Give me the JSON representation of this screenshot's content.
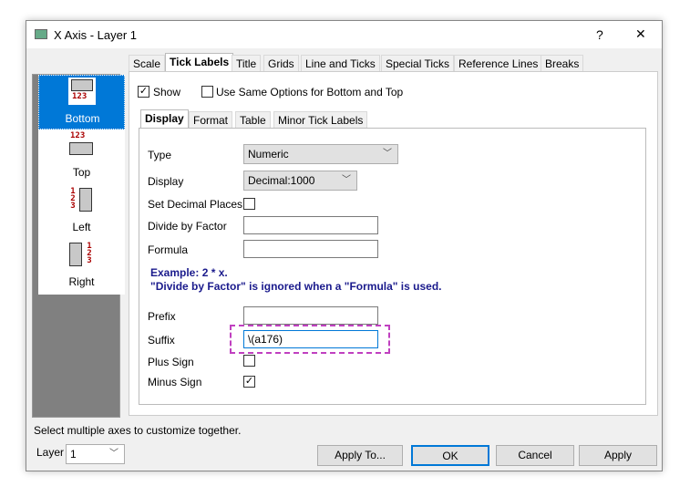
{
  "window": {
    "title": "X Axis - Layer 1",
    "help": "?",
    "close": "✕"
  },
  "tabs": [
    {
      "label": "Scale"
    },
    {
      "label": "Tick Labels",
      "active": true
    },
    {
      "label": "Title"
    },
    {
      "label": "Grids"
    },
    {
      "label": "Line and Ticks"
    },
    {
      "label": "Special Ticks"
    },
    {
      "label": "Reference Lines"
    },
    {
      "label": "Breaks"
    }
  ],
  "sidebar": {
    "items": [
      {
        "label": "Bottom",
        "selected": true,
        "digits": "123"
      },
      {
        "label": "Top",
        "digits": "123"
      },
      {
        "label": "Left",
        "digits": "123"
      },
      {
        "label": "Right",
        "digits": "123"
      }
    ]
  },
  "show": {
    "label": "Show",
    "checked": true
  },
  "same_options": {
    "label": "Use Same Options for Bottom and Top",
    "checked": false
  },
  "subtabs": [
    {
      "label": "Display",
      "active": true
    },
    {
      "label": "Format"
    },
    {
      "label": "Table"
    },
    {
      "label": "Minor Tick Labels"
    }
  ],
  "form": {
    "type": {
      "label": "Type",
      "value": "Numeric"
    },
    "display": {
      "label": "Display",
      "value": "Decimal:1000"
    },
    "set_decimal": {
      "label": "Set Decimal Places",
      "checked": false
    },
    "divide": {
      "label": "Divide by Factor",
      "value": ""
    },
    "formula": {
      "label": "Formula",
      "value": ""
    },
    "note1": "Example: 2 * x.",
    "note2": "\"Divide by Factor\" is ignored when a \"Formula\" is used.",
    "prefix": {
      "label": "Prefix",
      "value": ""
    },
    "suffix": {
      "label": "Suffix",
      "value": "\\(a176)"
    },
    "plus": {
      "label": "Plus Sign",
      "checked": false
    },
    "minus": {
      "label": "Minus Sign",
      "checked": true
    }
  },
  "status": "Select multiple axes to customize together.",
  "layer": {
    "label": "Layer",
    "value": "1"
  },
  "buttons": {
    "apply_to": "Apply To...",
    "ok": "OK",
    "cancel": "Cancel",
    "apply": "Apply"
  },
  "colors": {
    "selection": "#0078d7",
    "note": "#1a1a8c",
    "highlight": "#c040c0"
  }
}
